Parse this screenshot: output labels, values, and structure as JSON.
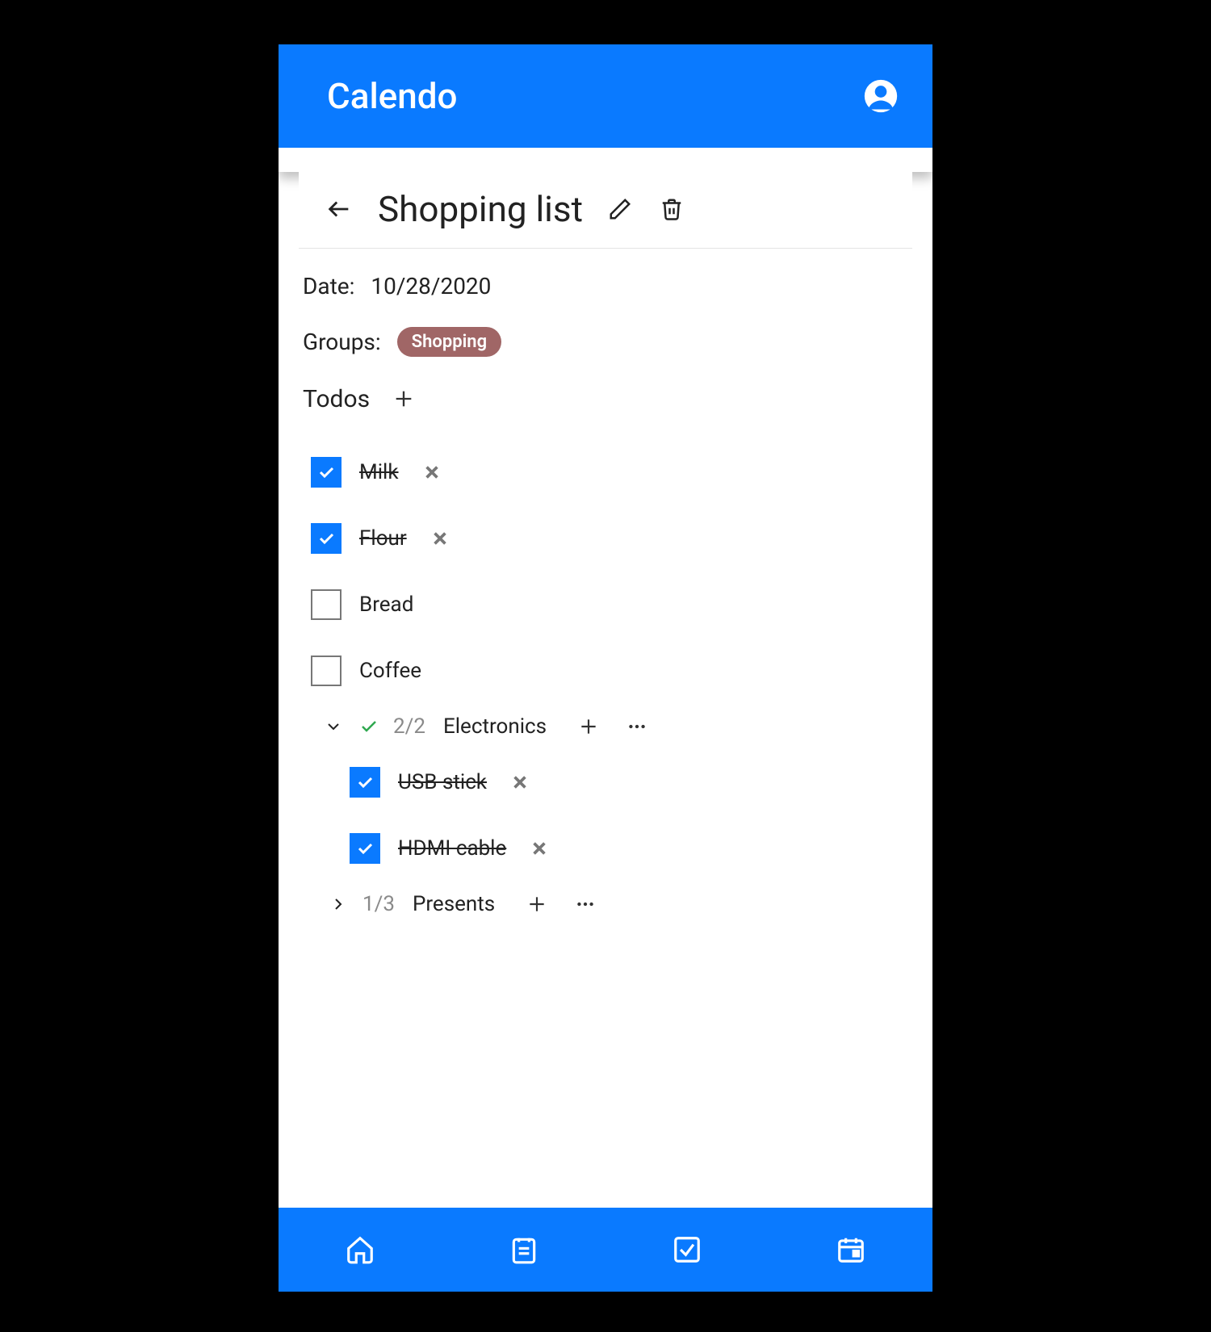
{
  "app": {
    "title": "Calendo"
  },
  "page": {
    "title": "Shopping list",
    "date_label": "Date:",
    "date_value": "10/28/2020",
    "groups_label": "Groups:",
    "group_tag": "Shopping",
    "todos_label": "Todos"
  },
  "todos": [
    {
      "label": "Milk",
      "done": true
    },
    {
      "label": "Flour",
      "done": true
    },
    {
      "label": "Bread",
      "done": false
    },
    {
      "label": "Coffee",
      "done": false
    }
  ],
  "subgroups": [
    {
      "name": "Electronics",
      "count": "2/2",
      "expanded": true,
      "complete": true,
      "items": [
        {
          "label": "USB stick",
          "done": true
        },
        {
          "label": "HDMI cable",
          "done": true
        }
      ]
    },
    {
      "name": "Presents",
      "count": "1/3",
      "expanded": false,
      "complete": false,
      "items": []
    }
  ]
}
